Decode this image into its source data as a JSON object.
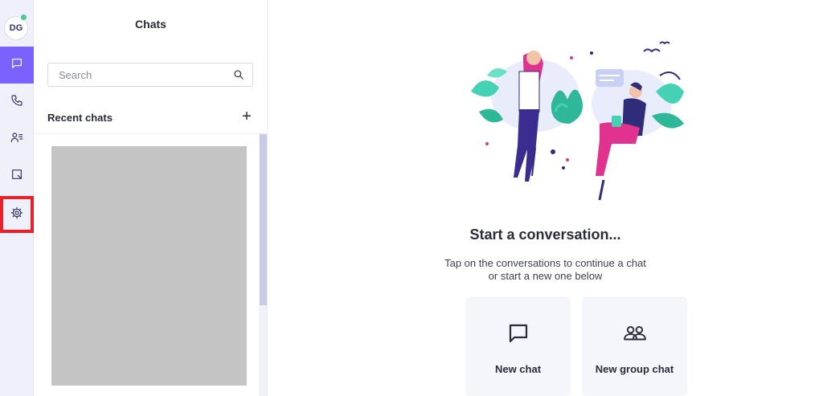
{
  "rail": {
    "avatar_initials": "DG",
    "items": [
      {
        "name": "chats",
        "icon": "chat-bubble-icon",
        "active": true
      },
      {
        "name": "calls",
        "icon": "phone-icon",
        "active": false
      },
      {
        "name": "contacts",
        "icon": "contacts-icon",
        "active": false
      },
      {
        "name": "notes",
        "icon": "note-icon",
        "active": false
      },
      {
        "name": "settings",
        "icon": "gear-icon",
        "active": false,
        "highlighted": true
      }
    ],
    "accent_color": "#7b61ff",
    "highlight_color": "#e8202a",
    "presence_color": "#4cc98a"
  },
  "panel": {
    "title": "Chats",
    "search": {
      "placeholder": "Search",
      "value": ""
    },
    "recent_label": "Recent chats",
    "add_label": "+"
  },
  "main": {
    "headline": "Start a conversation...",
    "subline_1": "Tap on the conversations to continue a chat",
    "subline_2": "or start a new one below",
    "cards": [
      {
        "label": "New chat",
        "icon": "chat-bubble-icon"
      },
      {
        "label": "New group chat",
        "icon": "group-icon"
      }
    ]
  }
}
